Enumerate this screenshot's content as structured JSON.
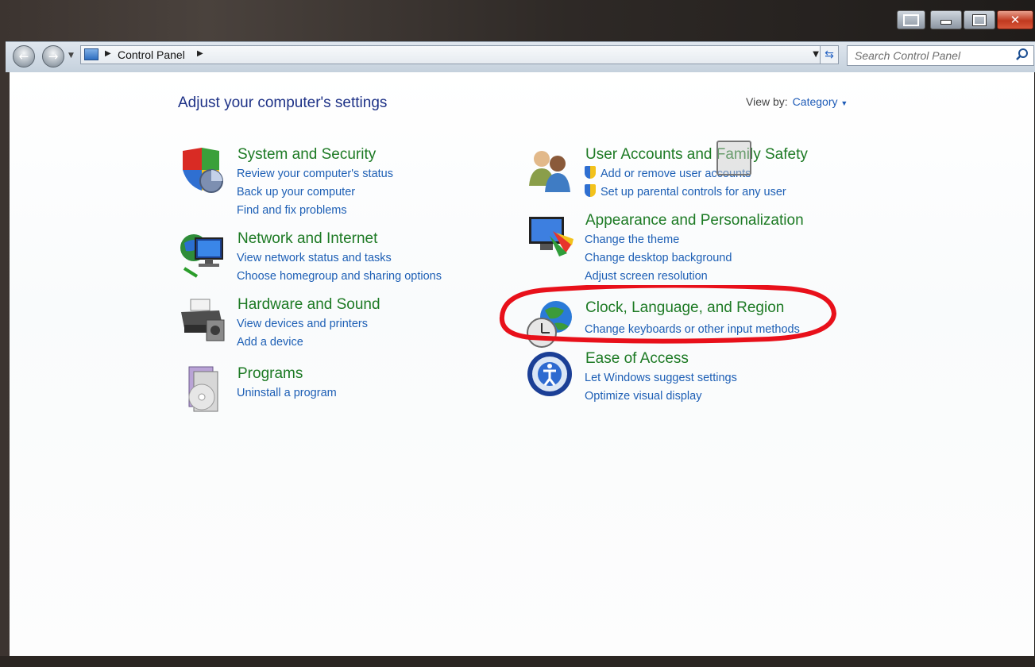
{
  "window": {
    "close_label": "✕"
  },
  "navbar": {
    "breadcrumb": "Control Panel",
    "search_placeholder": "Search Control Panel"
  },
  "header": {
    "title": "Adjust your computer's settings",
    "view_by_label": "View by:",
    "view_by_value": "Category"
  },
  "categories": [
    {
      "title": "System and Security",
      "icon": "shield-icon",
      "links": [
        "Review your computer's status",
        "Back up your computer",
        "Find and fix problems"
      ]
    },
    {
      "title": "Network and Internet",
      "icon": "network-globe-icon",
      "links": [
        "View network status and tasks",
        "Choose homegroup and sharing options"
      ]
    },
    {
      "title": "Hardware and Sound",
      "icon": "printer-icon",
      "links": [
        "View devices and printers",
        "Add a device"
      ]
    },
    {
      "title": "Programs",
      "icon": "programs-disc-icon",
      "links": [
        "Uninstall a program"
      ]
    },
    {
      "title": "User Accounts and Family Safety",
      "icon": "users-icon",
      "links": [
        "Add or remove user accounts",
        "Set up parental controls for any user"
      ]
    },
    {
      "title": "Appearance and Personalization",
      "icon": "monitor-palette-icon",
      "links": [
        "Change the theme",
        "Change desktop background",
        "Adjust screen resolution"
      ]
    },
    {
      "title": "Clock, Language, and Region",
      "icon": "clock-globe-icon",
      "links": [
        "Change keyboards or other input methods"
      ]
    },
    {
      "title": "Ease of Access",
      "icon": "ease-of-access-icon",
      "links": [
        "Let Windows suggest settings",
        "Optimize visual display"
      ]
    }
  ],
  "colors": {
    "category_title": "#1d7a24",
    "link": "#1d5fb5",
    "page_title": "#1e3287",
    "annotation": "#e8101a"
  }
}
